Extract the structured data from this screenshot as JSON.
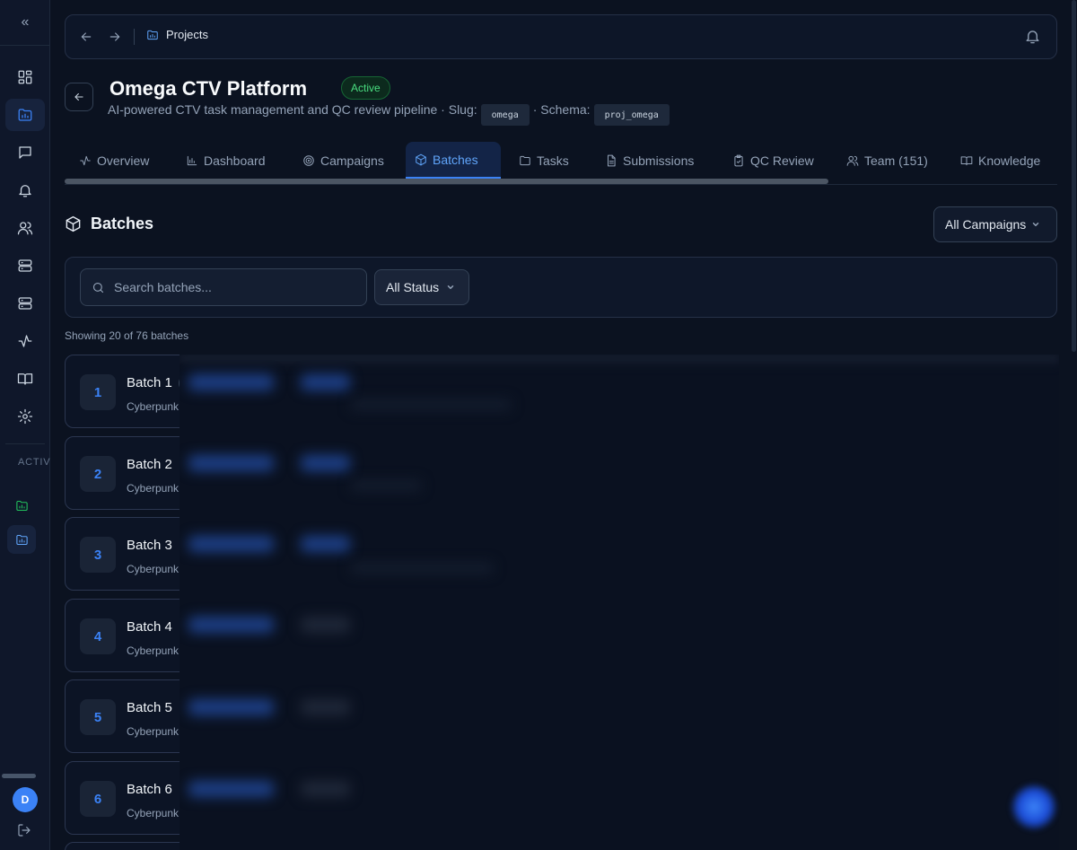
{
  "sidebar": {
    "collapse_icon": "double-chevron-left-icon",
    "nav": [
      {
        "name": "dashboard",
        "icon": "grid-icon",
        "active": false
      },
      {
        "name": "projects",
        "icon": "folder-chart-icon",
        "active": true
      },
      {
        "name": "messages",
        "icon": "chat-icon",
        "active": false
      },
      {
        "name": "notifications",
        "icon": "bell-icon",
        "active": false
      },
      {
        "name": "users",
        "icon": "users-icon",
        "active": false
      },
      {
        "name": "servers",
        "icon": "server-icon",
        "active": false
      },
      {
        "name": "databases",
        "icon": "server-icon",
        "active": false
      },
      {
        "name": "activity",
        "icon": "activity-icon",
        "active": false
      },
      {
        "name": "docs",
        "icon": "book-icon",
        "active": false
      },
      {
        "name": "settings",
        "icon": "gear-icon",
        "active": false
      }
    ],
    "section_label": "ACTIVE PROJECTS",
    "user_initial": "D"
  },
  "topbar": {
    "breadcrumb": "Projects"
  },
  "project": {
    "title": "Omega CTV Platform",
    "status": "Active",
    "description": "AI-powered CTV task management and QC review pipeline · Slug:",
    "slug": "omega",
    "schema_label": "· Schema:",
    "schema": "proj_omega"
  },
  "tabs": [
    {
      "label": "Overview",
      "icon": "activity-icon"
    },
    {
      "label": "Dashboard",
      "icon": "bar-chart-icon"
    },
    {
      "label": "Campaigns",
      "icon": "target-icon"
    },
    {
      "label": "Batches",
      "icon": "box-icon",
      "active": true
    },
    {
      "label": "Tasks",
      "icon": "folder-icon"
    },
    {
      "label": "Submissions",
      "icon": "document-icon"
    },
    {
      "label": "QC Review",
      "icon": "clipboard-check-icon"
    },
    {
      "label": "Team (151)",
      "icon": "users-icon"
    },
    {
      "label": "Knowledge",
      "icon": "book-icon"
    }
  ],
  "section": {
    "title": "Batches",
    "campaign_filter": "All Campaigns"
  },
  "filters": {
    "search_placeholder": "Search batches...",
    "status": "All Status"
  },
  "summary": "Showing 20 of 76 batches",
  "batches": [
    {
      "num": "1",
      "name": "Batch 1",
      "campaign": "Cyberpunk"
    },
    {
      "num": "2",
      "name": "Batch 2",
      "campaign": "Cyberpunk"
    },
    {
      "num": "3",
      "name": "Batch 3",
      "campaign": "Cyberpunk"
    },
    {
      "num": "4",
      "name": "Batch 4",
      "campaign": "Cyberpunk"
    },
    {
      "num": "5",
      "name": "Batch 5",
      "campaign": "Cyberpunk"
    },
    {
      "num": "6",
      "name": "Batch 6",
      "campaign": "Cyberpunk"
    }
  ],
  "colors": {
    "accent": "#3b82f6",
    "active_green": "#4ade80",
    "background": "#0b1220"
  }
}
